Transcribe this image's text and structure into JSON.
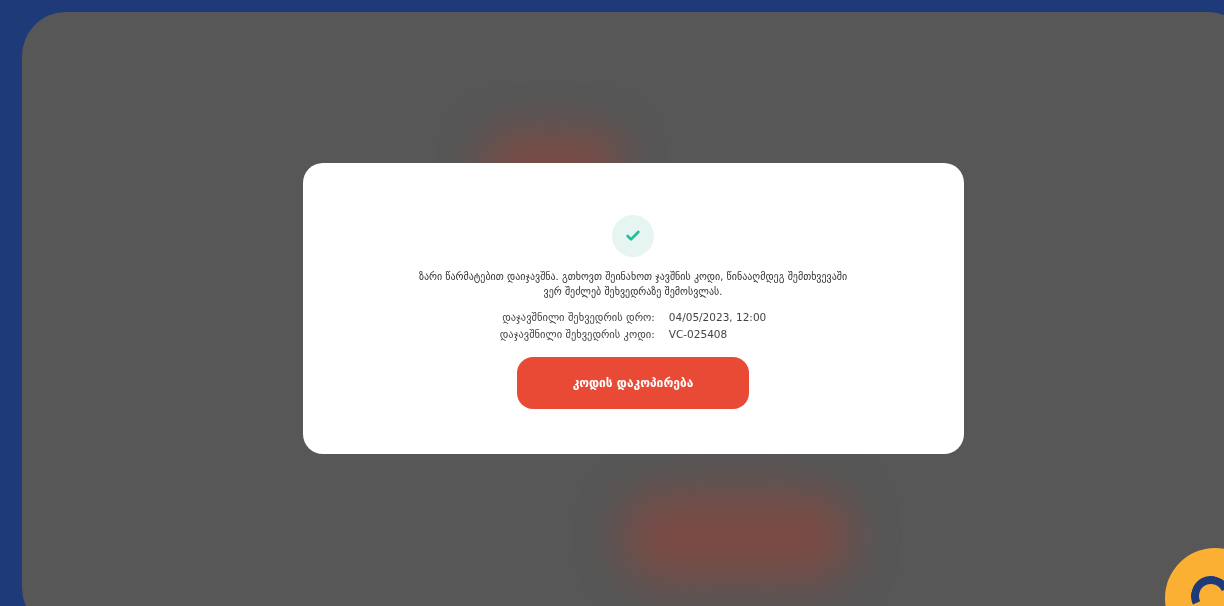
{
  "dialog": {
    "message": "ზარი წარმატებით დაიჯავშნა. გთხოვთ შეინახოთ ჯავშნის კოდი, წინააღმდეგ შემთხვევაში ვერ შეძლებ შეხვედრაზე შემოსვლას.",
    "details": [
      {
        "label": "დაჯავშნილი შეხვედრის დრო:",
        "value": "04/05/2023, 12:00"
      },
      {
        "label": "დაჯავშნილი შეხვედრის კოდი:",
        "value": "VC-025408"
      }
    ],
    "button": "კოდის დაკოპირება"
  }
}
